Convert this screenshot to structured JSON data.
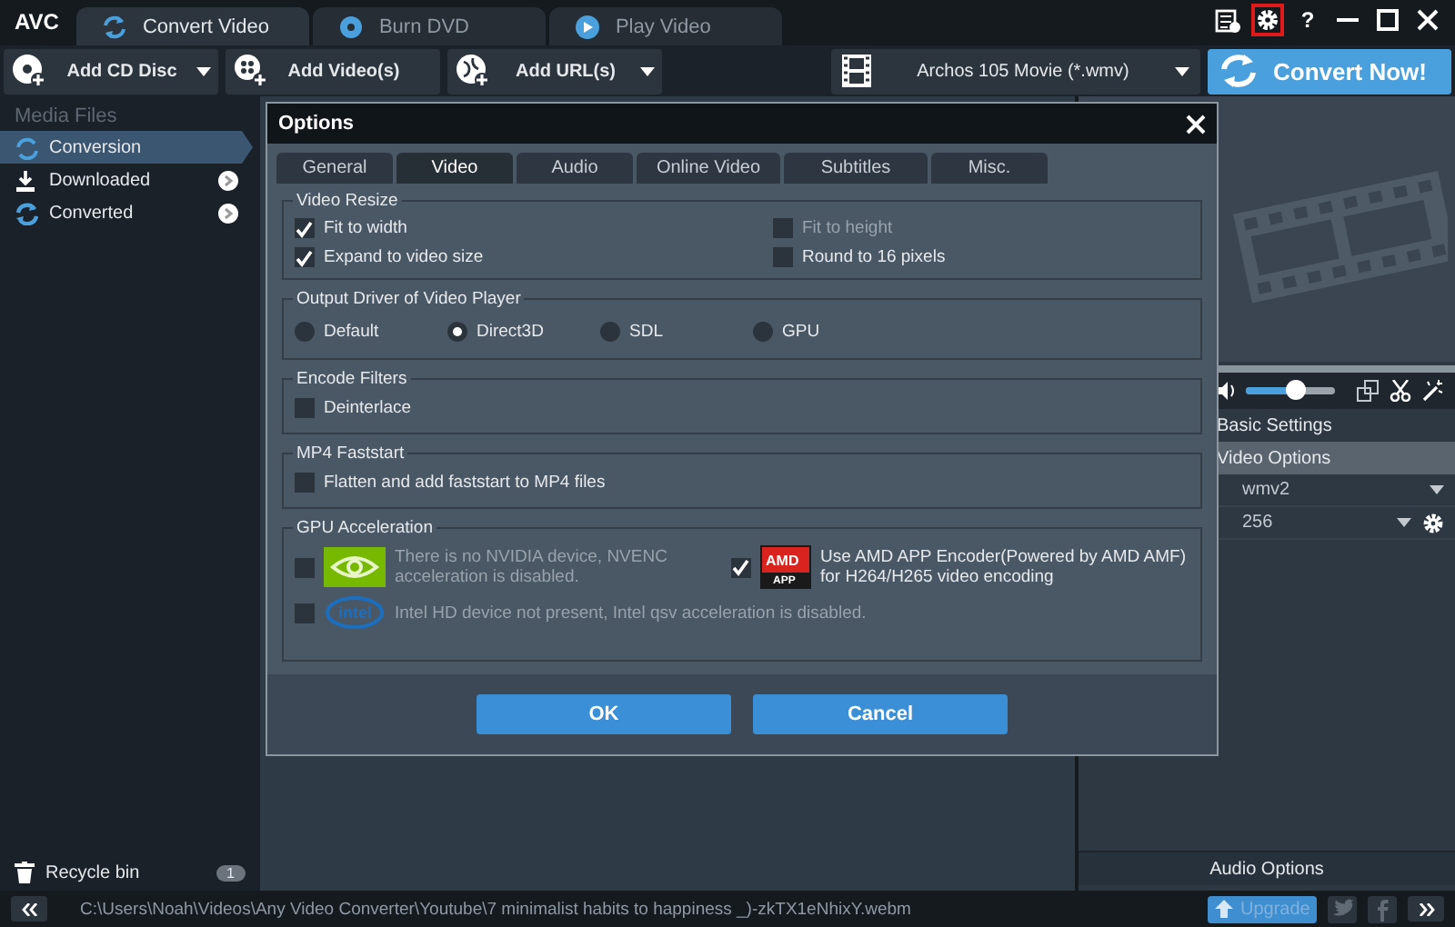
{
  "app": {
    "logo": "AVC",
    "tabs": [
      {
        "label": "Convert Video",
        "kind": "convert",
        "selected": true
      },
      {
        "label": "Burn DVD",
        "kind": "burn",
        "selected": false
      },
      {
        "label": "Play Video",
        "kind": "play",
        "selected": false
      }
    ],
    "title_buttons": [
      {
        "kind": "log",
        "highlighted": false
      },
      {
        "kind": "settings",
        "highlighted": true
      },
      {
        "kind": "help",
        "label": "?",
        "highlighted": false
      },
      {
        "kind": "minimize",
        "highlighted": false
      },
      {
        "kind": "maximize",
        "highlighted": false
      },
      {
        "kind": "close",
        "highlighted": false
      }
    ]
  },
  "toolbar": {
    "buttons": [
      {
        "kind": "disc",
        "label": "Add CD Disc",
        "dropdown": true
      },
      {
        "kind": "video",
        "label": "Add Video(s)",
        "dropdown": false
      },
      {
        "kind": "url",
        "label": "Add URL(s)",
        "dropdown": true
      }
    ],
    "profile": "Archos 105 Movie (*.wmv)",
    "convert": "Convert Now!"
  },
  "sidebar": {
    "header": "Media Files",
    "items": [
      {
        "kind": "conversion",
        "label": "Conversion",
        "selected": true,
        "go_button": false
      },
      {
        "kind": "download",
        "label": "Downloaded",
        "selected": false,
        "go_button": true
      },
      {
        "kind": "converted",
        "label": "Converted",
        "selected": false,
        "go_button": true
      }
    ],
    "recycle": {
      "label": "Recycle bin",
      "count": "1"
    }
  },
  "right_panel": {
    "volume": {
      "level": 0.55
    },
    "sections": [
      {
        "label": "Basic Settings",
        "selected": false
      },
      {
        "label": "Video Options",
        "selected": true
      }
    ],
    "fields": [
      {
        "value": "wmv2",
        "settings": false
      },
      {
        "value": "256",
        "settings": true
      }
    ],
    "footer": "Audio Options"
  },
  "dialog": {
    "title": "Options",
    "tabs": [
      {
        "label": "General",
        "selected": false
      },
      {
        "label": "Video",
        "selected": true
      },
      {
        "label": "Audio",
        "selected": false
      },
      {
        "label": "Online Video",
        "selected": false
      },
      {
        "label": "Subtitles",
        "selected": false
      },
      {
        "label": "Misc.",
        "selected": false
      }
    ],
    "groups": [
      {
        "title": "Video Resize",
        "kind": "pairs",
        "items": [
          {
            "kind": "checkbox",
            "label": "Fit to width",
            "checked": true,
            "disabled": false
          },
          {
            "kind": "checkbox",
            "label": "Fit to height",
            "checked": false,
            "disabled": true
          },
          {
            "kind": "checkbox",
            "label": "Expand to video size",
            "checked": true,
            "disabled": false
          },
          {
            "kind": "checkbox",
            "label": "Round to 16 pixels",
            "checked": false,
            "disabled": false
          }
        ]
      },
      {
        "title": "Output Driver of Video Player",
        "kind": "radios",
        "items": [
          {
            "kind": "radio",
            "label": "Default",
            "selected": false
          },
          {
            "kind": "radio",
            "label": "Direct3D",
            "selected": true
          },
          {
            "kind": "radio",
            "label": "SDL",
            "selected": false
          },
          {
            "kind": "radio",
            "label": "GPU",
            "selected": false
          }
        ]
      },
      {
        "title": "Encode Filters",
        "kind": "single",
        "items": [
          {
            "kind": "checkbox",
            "label": "Deinterlace",
            "checked": false,
            "disabled": false
          }
        ]
      },
      {
        "title": "MP4 Faststart",
        "kind": "single",
        "items": [
          {
            "kind": "checkbox",
            "label": "Flatten and add faststart to MP4 files",
            "checked": false,
            "disabled": false
          }
        ]
      },
      {
        "title": "GPU Acceleration",
        "kind": "gpu",
        "items": [
          {
            "kind": "nvidia",
            "label": "There is no NVIDIA device, NVENC acceleration is disabled.",
            "checked": false,
            "disabled": true
          },
          {
            "kind": "amd",
            "label": "Use AMD APP Encoder(Powered by AMD AMF) for H264/H265 video encoding",
            "logo_lines": [
              "AMD",
              "APP"
            ],
            "checked": true,
            "disabled": false
          },
          {
            "kind": "intel",
            "label": "Intel HD device not present, Intel qsv acceleration is disabled.",
            "logo_lines": [
              "intel"
            ],
            "checked": false,
            "disabled": true
          }
        ]
      }
    ],
    "buttons": [
      "OK",
      "Cancel"
    ]
  },
  "status_bar": {
    "path": "C:\\Users\\Noah\\Videos\\Any Video Converter\\Youtube\\7 minimalist habits to happiness _)-zkTX1eNhixY.webm",
    "upgrade": "Upgrade"
  }
}
